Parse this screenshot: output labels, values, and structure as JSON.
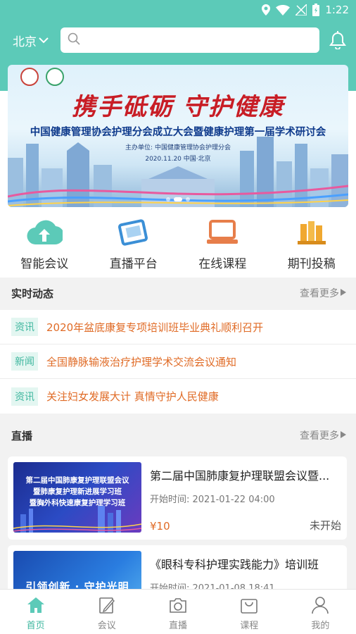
{
  "status_bar": {
    "time": "1:22"
  },
  "header": {
    "city": "北京",
    "search_placeholder": ""
  },
  "banner": {
    "slogan": "携手砥砺  守护健康",
    "subtitle": "中国健康管理协会护理分会成立大会暨健康护理第一届学术研讨会",
    "host": "主办单位:  中国健康管理协会护理分会",
    "date": "2020.11.20  中国·北京"
  },
  "quick_menu": [
    {
      "label": "智能会议",
      "icon": "cloud-upload-icon"
    },
    {
      "label": "直播平台",
      "icon": "tablet-icon"
    },
    {
      "label": "在线课程",
      "icon": "laptop-icon"
    },
    {
      "label": "期刊投稿",
      "icon": "books-icon"
    }
  ],
  "news_section": {
    "title": "实时动态",
    "more": "查看更多",
    "items": [
      {
        "tag": "资讯",
        "title": "2020年盆底康复专项培训班毕业典礼顺利召开"
      },
      {
        "tag": "新闻",
        "title": "全国静脉输液治疗护理学术交流会议通知"
      },
      {
        "tag": "资讯",
        "title": "关注妇女发展大计 真情守护人民健康"
      }
    ]
  },
  "live_section": {
    "title": "直播",
    "more": "查看更多",
    "items": [
      {
        "title": "第二届中国肺康复护理联盟会议暨...",
        "time": "开始时间:  2021-01-22 04:00",
        "price": "¥10",
        "status": "未开始",
        "thumb_lines": [
          "第二届中国肺康复护理联盟会议",
          "暨肺康复护理新进展学习班",
          "暨胸外科快速康复护理学习班"
        ]
      },
      {
        "title": "《眼科专科护理实践能力》培训班",
        "time": "开始时间:  2021-01-08 18:41",
        "thumb_slogan": "引领创新 · 守护光明"
      }
    ]
  },
  "tabbar": [
    {
      "label": "首页",
      "icon": "home-icon",
      "active": true
    },
    {
      "label": "会议",
      "icon": "edit-icon",
      "active": false
    },
    {
      "label": "直播",
      "icon": "camera-icon",
      "active": false
    },
    {
      "label": "课程",
      "icon": "bag-icon",
      "active": false
    },
    {
      "label": "我的",
      "icon": "user-icon",
      "active": false
    }
  ],
  "colors": {
    "primary": "#5ccab8",
    "accent": "#3fb79f",
    "highlight": "#e06b26"
  }
}
